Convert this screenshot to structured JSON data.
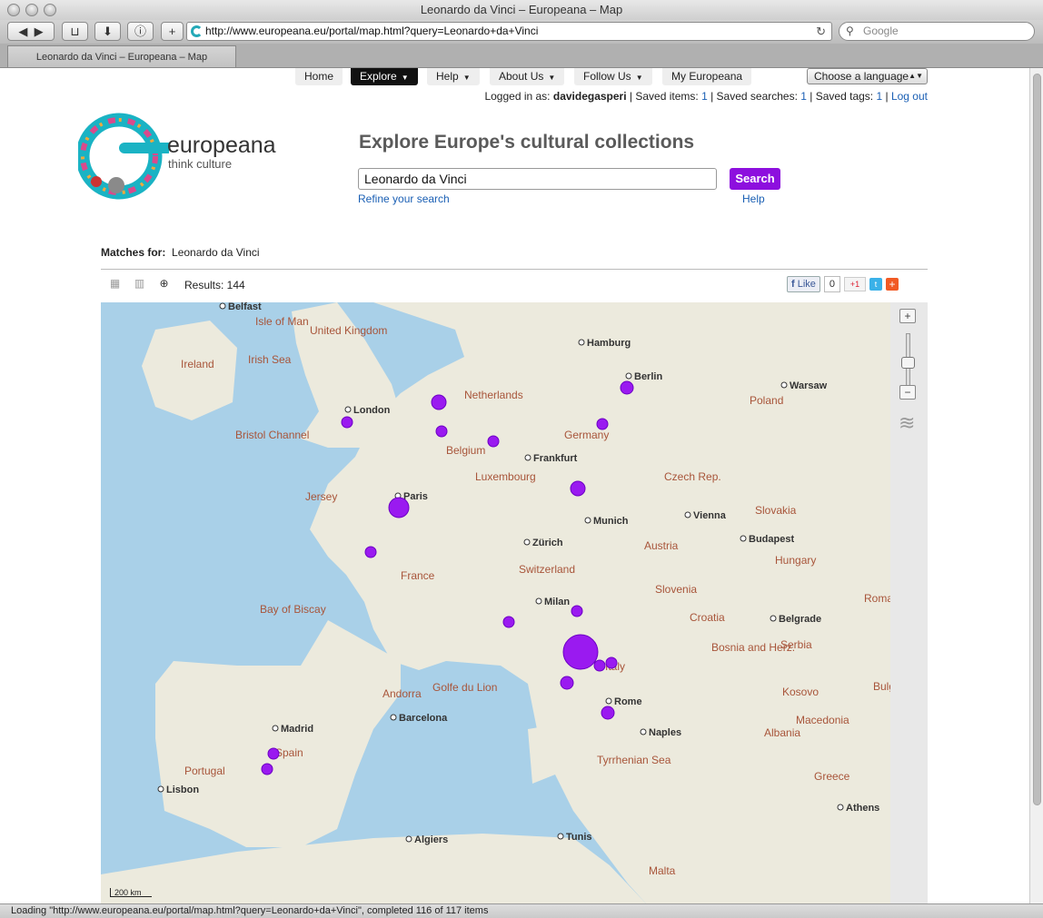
{
  "window": {
    "title": "Leonardo da Vinci – Europeana – Map",
    "tab_title": "Leonardo da Vinci – Europeana – Map",
    "url": "http://www.europeana.eu/portal/map.html?query=Leonardo+da+Vinci",
    "search_placeholder": "Google"
  },
  "status": "Loading \"http://www.europeana.eu/portal/map.html?query=Leonardo+da+Vinci\", completed 116 of 117 items",
  "nav": {
    "items": [
      "Home",
      "Explore",
      "Help",
      "About Us",
      "Follow Us",
      "My Europeana"
    ],
    "language": "Choose a language"
  },
  "login": {
    "prefix": "Logged in as: ",
    "user": "davidegasperi",
    "saved_items": "Saved items: ",
    "saved_items_n": "1",
    "saved_searches": "Saved searches: ",
    "saved_searches_n": "1",
    "saved_tags": "Saved tags: ",
    "saved_tags_n": "1",
    "logout": "Log out"
  },
  "brand": {
    "name": "europeana",
    "tagline": "think culture"
  },
  "hero": {
    "headline": "Explore Europe's cultural collections",
    "query": "Leonardo da Vinci",
    "search_button": "Search",
    "refine": "Refine your search",
    "help": "Help"
  },
  "results": {
    "matches_label": "Matches for:",
    "matches_value": "Leonardo da Vinci",
    "count_text": "Results: 144",
    "like": "Like",
    "like_count": "0",
    "gplus": "+1"
  },
  "map": {
    "scale": "200 km",
    "regions": [
      "Ireland",
      "United Kingdom",
      "Isle of Man",
      "Irish Sea",
      "Bristol Channel",
      "Jersey",
      "Netherlands",
      "Belgium",
      "Luxembourg",
      "Germany",
      "Poland",
      "Czech Rep.",
      "Slovakia",
      "Austria",
      "Hungary",
      "Switzerland",
      "France",
      "Bay of Biscay",
      "Slovenia",
      "Croatia",
      "Bosnia and Herz.",
      "Serbia",
      "Romania",
      "Kosovo",
      "Bulgaria",
      "Macedonia",
      "Albania",
      "Greece",
      "Italy",
      "Andorra",
      "Golfe du Lion",
      "Tyrrhenian Sea",
      "Spain",
      "Portugal",
      "Malta"
    ],
    "cities": [
      "Belfast",
      "London",
      "Paris",
      "Berlin",
      "Warsaw",
      "Hamburg",
      "Frankfurt",
      "Munich",
      "Vienna",
      "Budapest",
      "Zürich",
      "Milan",
      "Rome",
      "Naples",
      "Madrid",
      "Barcelona",
      "Lisbon",
      "Algiers",
      "Tunis",
      "Belgrade",
      "Athens"
    ]
  }
}
